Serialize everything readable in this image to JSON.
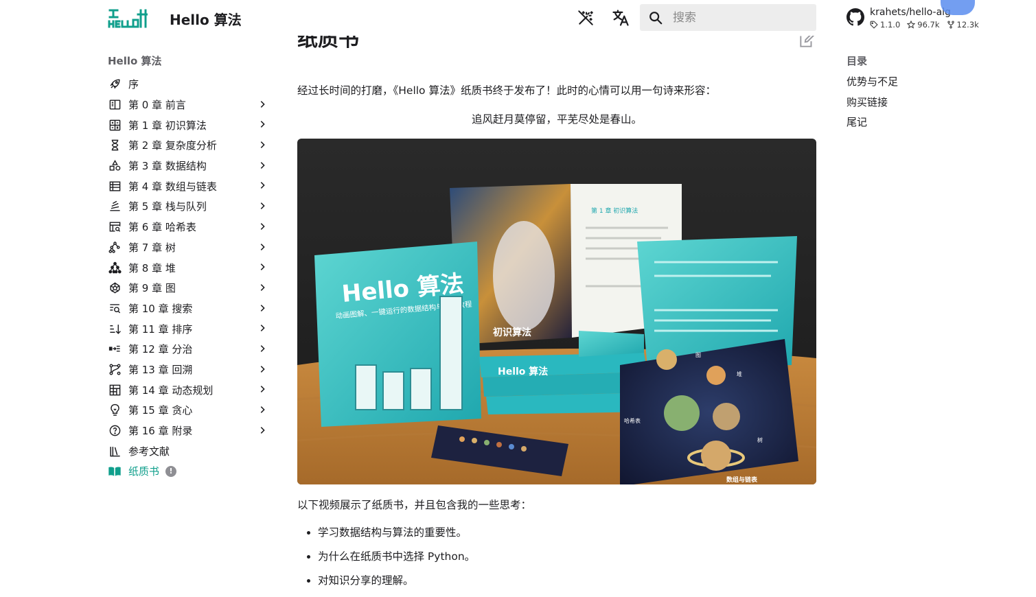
{
  "header": {
    "site_title": "Hello 算法",
    "search_placeholder": "搜索",
    "repo": {
      "name": "krahets/hello-algo",
      "version": "1.1.0",
      "stars": "96.7k",
      "forks": "12.3k"
    }
  },
  "nav": {
    "heading": "Hello 算法",
    "items": [
      {
        "label": "序",
        "icon": "rocket-icon",
        "chevron": false
      },
      {
        "label": "第 0 章   前言",
        "icon": "book-open-icon",
        "chevron": true
      },
      {
        "label": "第 1 章   初识算法",
        "icon": "calculator-icon",
        "chevron": true
      },
      {
        "label": "第 2 章   复杂度分析",
        "icon": "hourglass-icon",
        "chevron": true
      },
      {
        "label": "第 3 章   数据结构",
        "icon": "shapes-icon",
        "chevron": true
      },
      {
        "label": "第 4 章   数组与链表",
        "icon": "table-list-icon",
        "chevron": true
      },
      {
        "label": "第 5 章   栈与队列",
        "icon": "stack-icon",
        "chevron": true
      },
      {
        "label": "第 6 章   哈希表",
        "icon": "table-search-icon",
        "chevron": true
      },
      {
        "label": "第 7 章   树",
        "icon": "tree-icon",
        "chevron": true
      },
      {
        "label": "第 8 章   堆",
        "icon": "heap-icon",
        "chevron": true
      },
      {
        "label": "第 9 章   图",
        "icon": "graph-icon",
        "chevron": true
      },
      {
        "label": "第 10 章   搜索",
        "icon": "text-search-icon",
        "chevron": true
      },
      {
        "label": "第 11 章   排序",
        "icon": "sort-icon",
        "chevron": true
      },
      {
        "label": "第 12 章   分治",
        "icon": "split-icon",
        "chevron": true
      },
      {
        "label": "第 13 章   回溯",
        "icon": "backtrack-icon",
        "chevron": true
      },
      {
        "label": "第 14 章   动态规划",
        "icon": "grid-icon",
        "chevron": true
      },
      {
        "label": "第 15 章   贪心",
        "icon": "lightbulb-icon",
        "chevron": true
      },
      {
        "label": "第 16 章   附录",
        "icon": "help-circle-icon",
        "chevron": true
      },
      {
        "label": "参考文献",
        "icon": "library-icon",
        "chevron": false
      },
      {
        "label": "纸质书",
        "icon": "open-book-icon",
        "chevron": false,
        "active": true,
        "badge": "!"
      }
    ]
  },
  "main": {
    "title": "纸质书",
    "intro": "经过长时间的打磨，《Hello 算法》纸质书终于发布了！此时的心情可以用一句诗来形容：",
    "quote": "追风赶月莫停留，平芜尽处是春山。",
    "photo_alt": "Hello 算法 纸质书",
    "photo_text": {
      "cover_title": "Hello 算法",
      "cover_subtitle": "动画图解、一键运行的数据结构与算法教程",
      "chapter_heading": "第 1 章   初识算法",
      "art_title": "初识算法",
      "spine_title": "Hello 算法",
      "card_labels": [
        "图",
        "堆",
        "哈希表",
        "树",
        "数组与链表"
      ]
    },
    "video_intro": "以下视频展示了纸质书，并且包含我的一些思考：",
    "bullets": [
      "学习数据结构与算法的重要性。",
      "为什么在纸质书中选择 Python。",
      "对知识分享的理解。"
    ]
  },
  "toc": {
    "heading": "目录",
    "items": [
      "优势与不足",
      "购买链接",
      "尾记"
    ]
  },
  "colors": {
    "accent": "#109f8c",
    "text": "#1d1d20",
    "muted": "#5e5e63",
    "search_bg": "#ededed"
  }
}
